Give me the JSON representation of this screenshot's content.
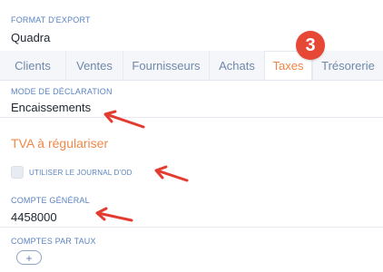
{
  "format": {
    "label": "FORMAT D'EXPORT",
    "value": "Quadra"
  },
  "tabs": [
    {
      "label": "Clients"
    },
    {
      "label": "Ventes"
    },
    {
      "label": "Fournisseurs"
    },
    {
      "label": "Achats"
    },
    {
      "label": "Taxes",
      "active": true
    },
    {
      "label": "Trésorerie"
    }
  ],
  "annotation": {
    "step": "3",
    "badge_color": "#e74735",
    "arrow_color": "#e33b2f"
  },
  "declaration": {
    "label": "MODE DE DÉCLARATION",
    "value": "Encaissements"
  },
  "vat_section": {
    "title": "TVA à régulariser"
  },
  "journal_option": {
    "label": "UTILISER LE JOURNAL D'OD",
    "checked": false
  },
  "general_account": {
    "label": "COMPTE GÉNÉRAL",
    "value": "4458000"
  },
  "accounts_by_rate": {
    "label": "COMPTES PAR TAUX",
    "add_button": "+"
  },
  "colors": {
    "accent_orange": "#ef8444",
    "label_blue": "#5a83bf",
    "tab_text": "#6f88a9",
    "tabs_background": "#f4f6fa"
  }
}
